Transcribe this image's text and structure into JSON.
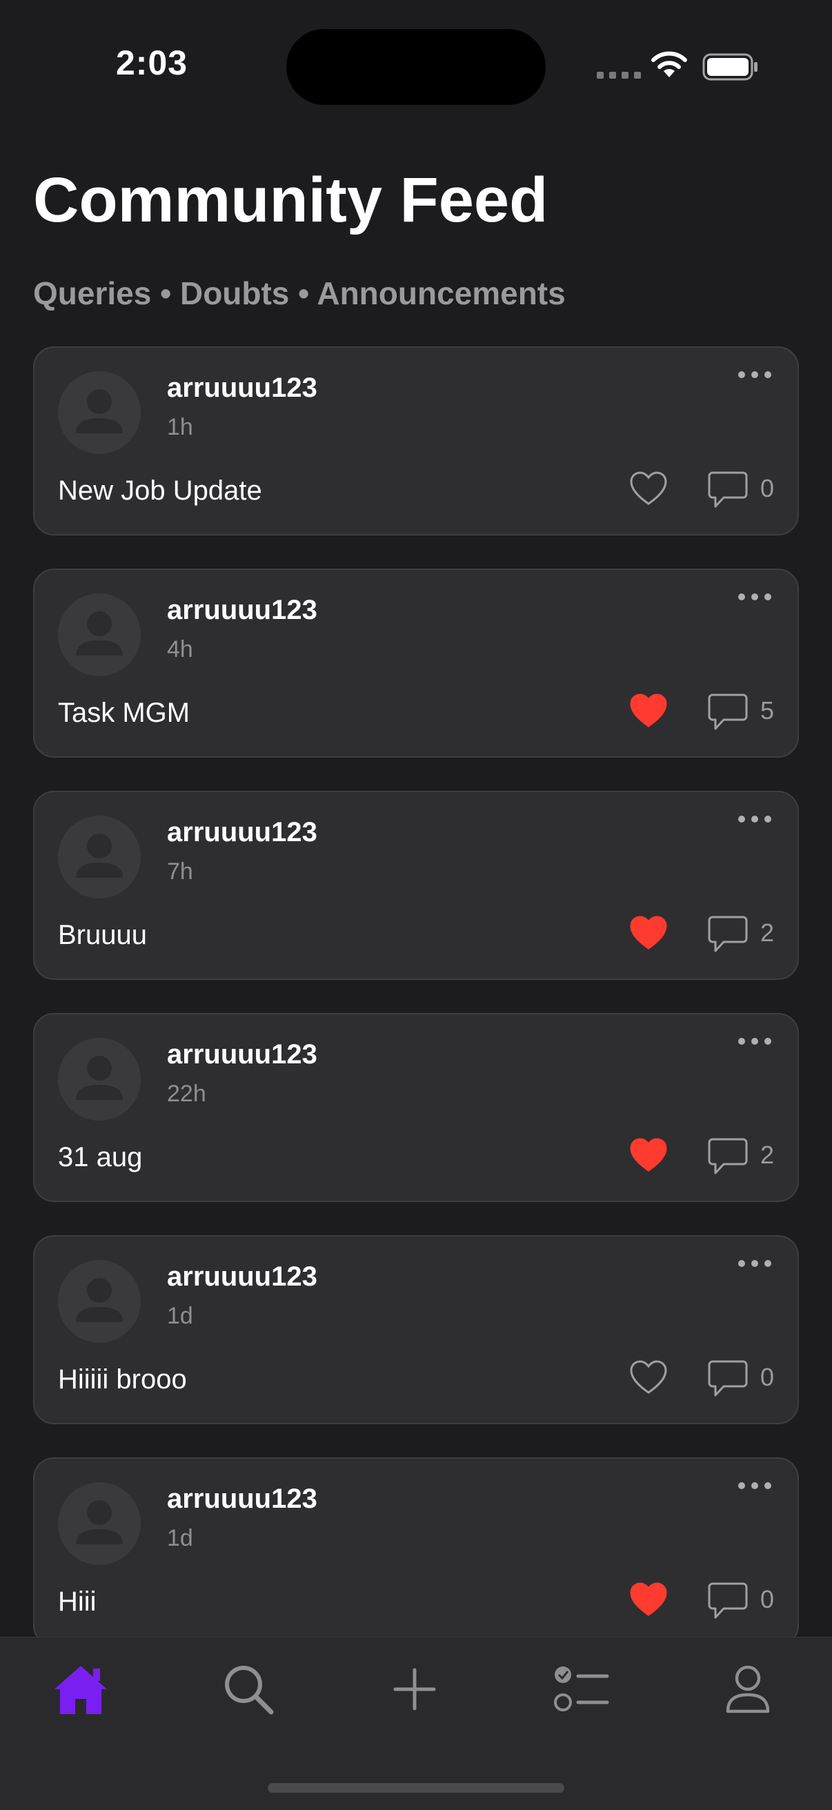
{
  "status_bar": {
    "time": "2:03"
  },
  "header": {
    "title": "Community Feed",
    "subtitle": "Queries • Doubts • Announcements"
  },
  "posts": [
    {
      "username": "arruuuu123",
      "time": "1h",
      "text": "New Job Update",
      "liked": false,
      "comments": "0"
    },
    {
      "username": "arruuuu123",
      "time": "4h",
      "text": "Task MGM",
      "liked": true,
      "comments": "5"
    },
    {
      "username": "arruuuu123",
      "time": "7h",
      "text": "Bruuuu",
      "liked": true,
      "comments": "2"
    },
    {
      "username": "arruuuu123",
      "time": "22h",
      "text": "31 aug",
      "liked": true,
      "comments": "2"
    },
    {
      "username": "arruuuu123",
      "time": "1d",
      "text": "Hiiiii brooo",
      "liked": false,
      "comments": "0"
    },
    {
      "username": "arruuuu123",
      "time": "1d",
      "text": "Hiii",
      "liked": true,
      "comments": "0"
    }
  ],
  "tab_bar": {
    "items": [
      {
        "icon": "home-icon",
        "active": true
      },
      {
        "icon": "search-icon",
        "active": false
      },
      {
        "icon": "plus-icon",
        "active": false
      },
      {
        "icon": "checklist-icon",
        "active": false
      },
      {
        "icon": "person-icon",
        "active": false
      }
    ]
  },
  "colors": {
    "accent": "#7a1ff2",
    "like": "#ff3b30",
    "background": "#1c1c1e",
    "card": "#2e2e30"
  }
}
